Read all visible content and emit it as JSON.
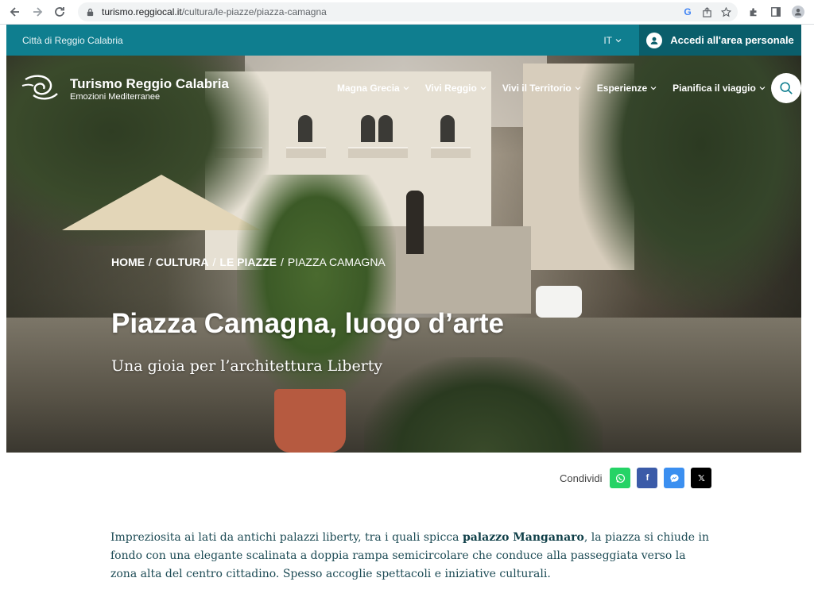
{
  "browser": {
    "url_host": "turismo.reggiocal.it",
    "url_path": "/cultura/le-piazze/piazza-camagna",
    "icons": [
      "back-icon",
      "forward-icon",
      "reload-icon",
      "lock-icon",
      "google-icon",
      "share-icon",
      "star-icon",
      "extensions-icon",
      "sidepanel-icon",
      "profile-icon"
    ],
    "google_glyph": "G"
  },
  "topbar": {
    "city": "Città di Reggio Calabria",
    "language": "IT",
    "login_label": "Accedi all'area personale"
  },
  "brand": {
    "name": "Turismo Reggio Calabria",
    "tagline": "Emozioni Mediterranee"
  },
  "nav": {
    "items": [
      {
        "label": "Magna Grecia"
      },
      {
        "label": "Vivi Reggio"
      },
      {
        "label": "Vivi il Territorio"
      },
      {
        "label": "Esperienze"
      },
      {
        "label": "Pianifica il viaggio"
      }
    ]
  },
  "breadcrumb": {
    "items": [
      "HOME",
      "CULTURA",
      "LE PIAZZE",
      "PIAZZA CAMAGNA"
    ],
    "separator": "/"
  },
  "hero": {
    "title": "Piazza Camagna, luogo d’arte",
    "subtitle": "Una gioia per l’architettura Liberty"
  },
  "share": {
    "label": "Condividi",
    "buttons": [
      {
        "name": "whatsapp",
        "color": "#25d366",
        "glyph": "✆"
      },
      {
        "name": "facebook",
        "color": "#3b5ba8",
        "glyph": "f"
      },
      {
        "name": "messenger",
        "color": "#3b8ff0",
        "glyph": "◔"
      },
      {
        "name": "x",
        "color": "#000000",
        "glyph": "𝕏"
      }
    ]
  },
  "content": {
    "part1": "Impreziosita ai lati da antichi palazzi liberty, tra i quali spicca ",
    "highlight": "palazzo Manganaro",
    "part2": ", la piazza si chiude in fondo con una elegante scalinata a doppia rampa semicircolare che conduce alla passeggiata verso la zona alta del centro cittadino. Spesso accoglie spettacoli e iniziative culturali."
  },
  "colors": {
    "topbar": "#0f7e8f",
    "login": "#0a5e6b",
    "body_text": "#1d4b55"
  }
}
